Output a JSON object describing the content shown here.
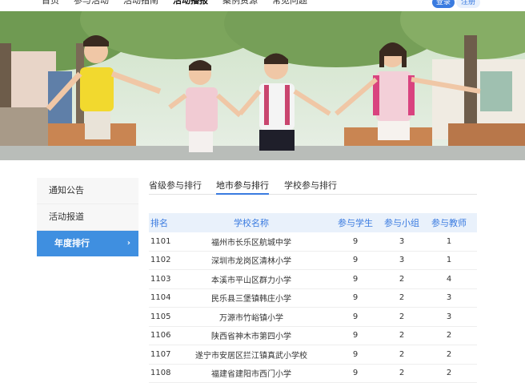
{
  "nav": {
    "items": [
      "首页",
      "参与活动",
      "活动指南",
      "活动播报",
      "案例资源",
      "常见问题"
    ],
    "active_index": 3,
    "login": "登录",
    "register": "注册"
  },
  "banner": {
    "icon": "children-running-photo"
  },
  "sidebar": {
    "items": [
      {
        "label": "通知公告"
      },
      {
        "label": "活动报道"
      },
      {
        "label": "年度排行"
      }
    ],
    "active_index": 2,
    "chevron": "›"
  },
  "tabs": {
    "items": [
      "省级参与排行",
      "地市参与排行",
      "学校参与排行"
    ],
    "active_index": 1
  },
  "table": {
    "headers": {
      "rank": "排名",
      "school": "学校名称",
      "students": "参与学生",
      "groups": "参与小组",
      "teachers": "参与教师"
    },
    "rows": [
      {
        "rank": "1101",
        "school": "福州市长乐区航城中学",
        "students": "9",
        "groups": "3",
        "teachers": "1"
      },
      {
        "rank": "1102",
        "school": "深圳市龙岗区清林小学",
        "students": "9",
        "groups": "3",
        "teachers": "1"
      },
      {
        "rank": "1103",
        "school": "本溪市平山区群力小学",
        "students": "9",
        "groups": "2",
        "teachers": "4"
      },
      {
        "rank": "1104",
        "school": "民乐县三堡镇韩庄小学",
        "students": "9",
        "groups": "2",
        "teachers": "3"
      },
      {
        "rank": "1105",
        "school": "万源市竹峪镇小学",
        "students": "9",
        "groups": "2",
        "teachers": "3"
      },
      {
        "rank": "1106",
        "school": "陕西省神木市第四小学",
        "students": "9",
        "groups": "2",
        "teachers": "2"
      },
      {
        "rank": "1107",
        "school": "遂宁市安居区拦江镇真武小学校",
        "students": "9",
        "groups": "2",
        "teachers": "2"
      },
      {
        "rank": "1108",
        "school": "福建省建阳市西门小学",
        "students": "9",
        "groups": "2",
        "teachers": "2"
      }
    ]
  }
}
